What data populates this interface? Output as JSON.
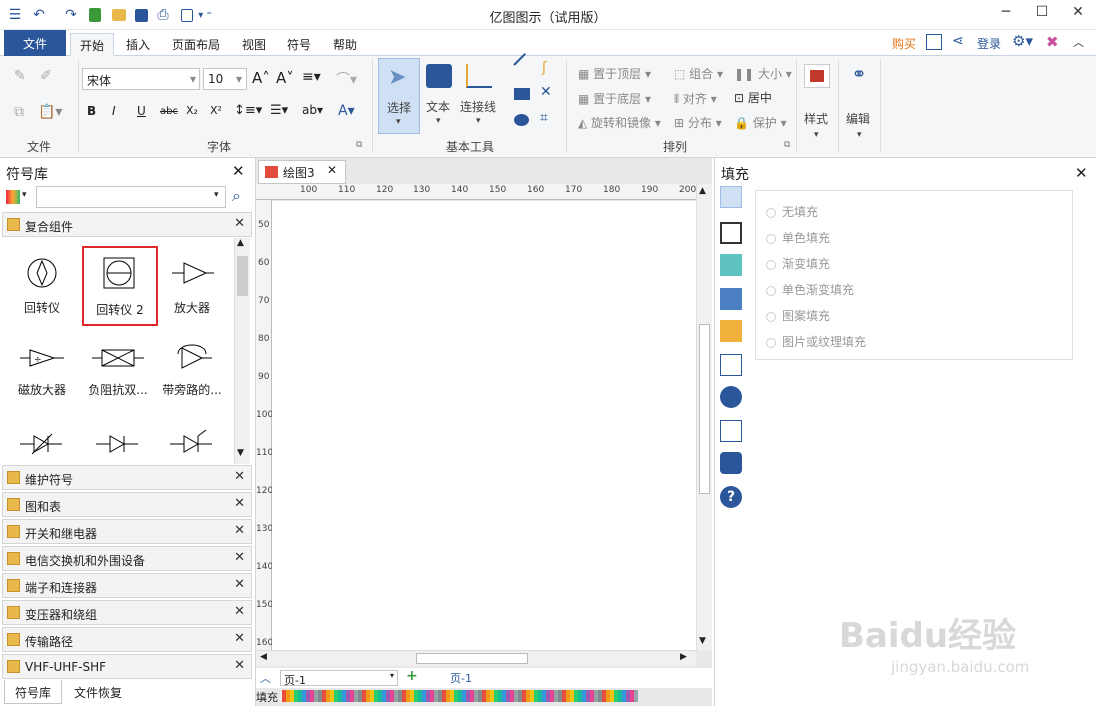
{
  "app": {
    "title": "亿图图示（试用版）"
  },
  "tabs": [
    {
      "label": "文件"
    },
    {
      "label": "开始"
    },
    {
      "label": "插入"
    },
    {
      "label": "页面布局"
    },
    {
      "label": "视图"
    },
    {
      "label": "符号"
    },
    {
      "label": "帮助"
    }
  ],
  "topright": {
    "buy": "购买",
    "login": "登录"
  },
  "ribbon": {
    "file_group": "文件",
    "font_group": "字体",
    "tools_group": "基本工具",
    "arrange_group": "排列",
    "font_name": "宋体",
    "font_size": "10",
    "select": "选择",
    "text": "文本",
    "connector": "连接线",
    "bring_front": "置于顶层",
    "send_back": "置于底层",
    "rotate": "旋转和镜像",
    "group": "组合",
    "align": "对齐",
    "distribute": "分布",
    "size": "大小",
    "center": "居中",
    "protect": "保护",
    "style": "样式",
    "edit": "编辑"
  },
  "library": {
    "title": "符号库",
    "search_placeholder": "",
    "open_category": "复合组件",
    "symbols": [
      "回转仪",
      "回转仪 2",
      "放大器",
      "磁放大器",
      "负阻抗双...",
      "带旁路的..."
    ],
    "categories": [
      "维护符号",
      "图和表",
      "开关和继电器",
      "电信交换机和外围设备",
      "端子和连接器",
      "变压器和绕组",
      "传输路径",
      "VHF-UHF-SHF"
    ],
    "bottom_tabs": [
      "符号库",
      "文件恢复"
    ]
  },
  "document": {
    "tab": "绘图3",
    "h_ruler": [
      "100",
      "110",
      "120",
      "130",
      "140",
      "150",
      "160",
      "170",
      "180",
      "190",
      "200"
    ],
    "v_ruler": [
      "50",
      "60",
      "70",
      "80",
      "90",
      "100",
      "110",
      "120",
      "130",
      "140",
      "150",
      "160"
    ],
    "page_select": "页-1",
    "page_tab": "页-1",
    "fill_label": "填充"
  },
  "fill_panel": {
    "title": "填充",
    "options": [
      "无填充",
      "单色填充",
      "渐变填充",
      "单色渐变填充",
      "图案填充",
      "图片或纹理填充"
    ]
  },
  "watermark": {
    "brand": "Baidu经验",
    "url": "jingyan.baidu.com"
  }
}
